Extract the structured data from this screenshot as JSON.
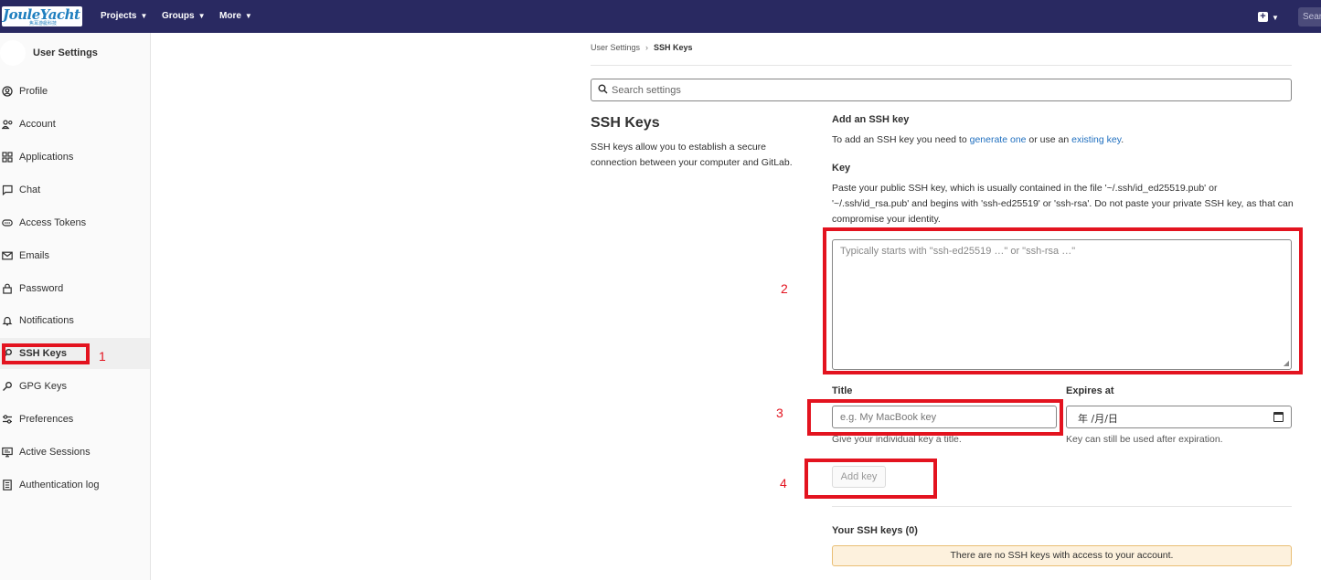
{
  "topbar": {
    "logo_text": "JouleYacht",
    "logo_sub": "焦耳游艇科技",
    "nav": [
      {
        "label": "Projects"
      },
      {
        "label": "Groups"
      },
      {
        "label": "More"
      }
    ],
    "search_placeholder": "Sear"
  },
  "sidebar": {
    "title": "User Settings",
    "items": [
      {
        "label": "Profile",
        "icon": "profile-icon"
      },
      {
        "label": "Account",
        "icon": "account-icon"
      },
      {
        "label": "Applications",
        "icon": "applications-icon"
      },
      {
        "label": "Chat",
        "icon": "chat-icon"
      },
      {
        "label": "Access Tokens",
        "icon": "token-icon"
      },
      {
        "label": "Emails",
        "icon": "email-icon"
      },
      {
        "label": "Password",
        "icon": "lock-icon"
      },
      {
        "label": "Notifications",
        "icon": "bell-icon"
      },
      {
        "label": "SSH Keys",
        "icon": "key-icon",
        "active": true
      },
      {
        "label": "GPG Keys",
        "icon": "key-icon"
      },
      {
        "label": "Preferences",
        "icon": "preferences-icon"
      },
      {
        "label": "Active Sessions",
        "icon": "monitor-icon"
      },
      {
        "label": "Authentication log",
        "icon": "log-icon"
      }
    ]
  },
  "breadcrumb": {
    "parent": "User Settings",
    "current": "SSH Keys"
  },
  "search": {
    "placeholder": "Search settings"
  },
  "section": {
    "title": "SSH Keys",
    "description": "SSH keys allow you to establish a secure connection between your computer and GitLab."
  },
  "add_key": {
    "heading": "Add an SSH key",
    "intro_prefix": "To add an SSH key you need to ",
    "generate_link": "generate one",
    "intro_middle": " or use an ",
    "existing_link": "existing key",
    "intro_suffix": ".",
    "key_label": "Key",
    "key_help": "Paste your public SSH key, which is usually contained in the file '~/.ssh/id_ed25519.pub' or '~/.ssh/id_rsa.pub' and begins with 'ssh-ed25519' or 'ssh-rsa'. Do not paste your private SSH key, as that can compromise your identity.",
    "key_placeholder": "Typically starts with \"ssh-ed25519 …\" or \"ssh-rsa …\"",
    "title_label": "Title",
    "title_placeholder": "e.g. My MacBook key",
    "title_help": "Give your individual key a title.",
    "expires_label": "Expires at",
    "expires_value": "年 /月/日",
    "expires_help": "Key can still be used after expiration.",
    "submit_label": "Add key"
  },
  "your_keys": {
    "heading": "Your SSH keys (0)",
    "empty_message": "There are no SSH keys with access to your account."
  },
  "annotations": {
    "color": "#e3131f",
    "labels": [
      "1",
      "2",
      "3",
      "4"
    ]
  }
}
